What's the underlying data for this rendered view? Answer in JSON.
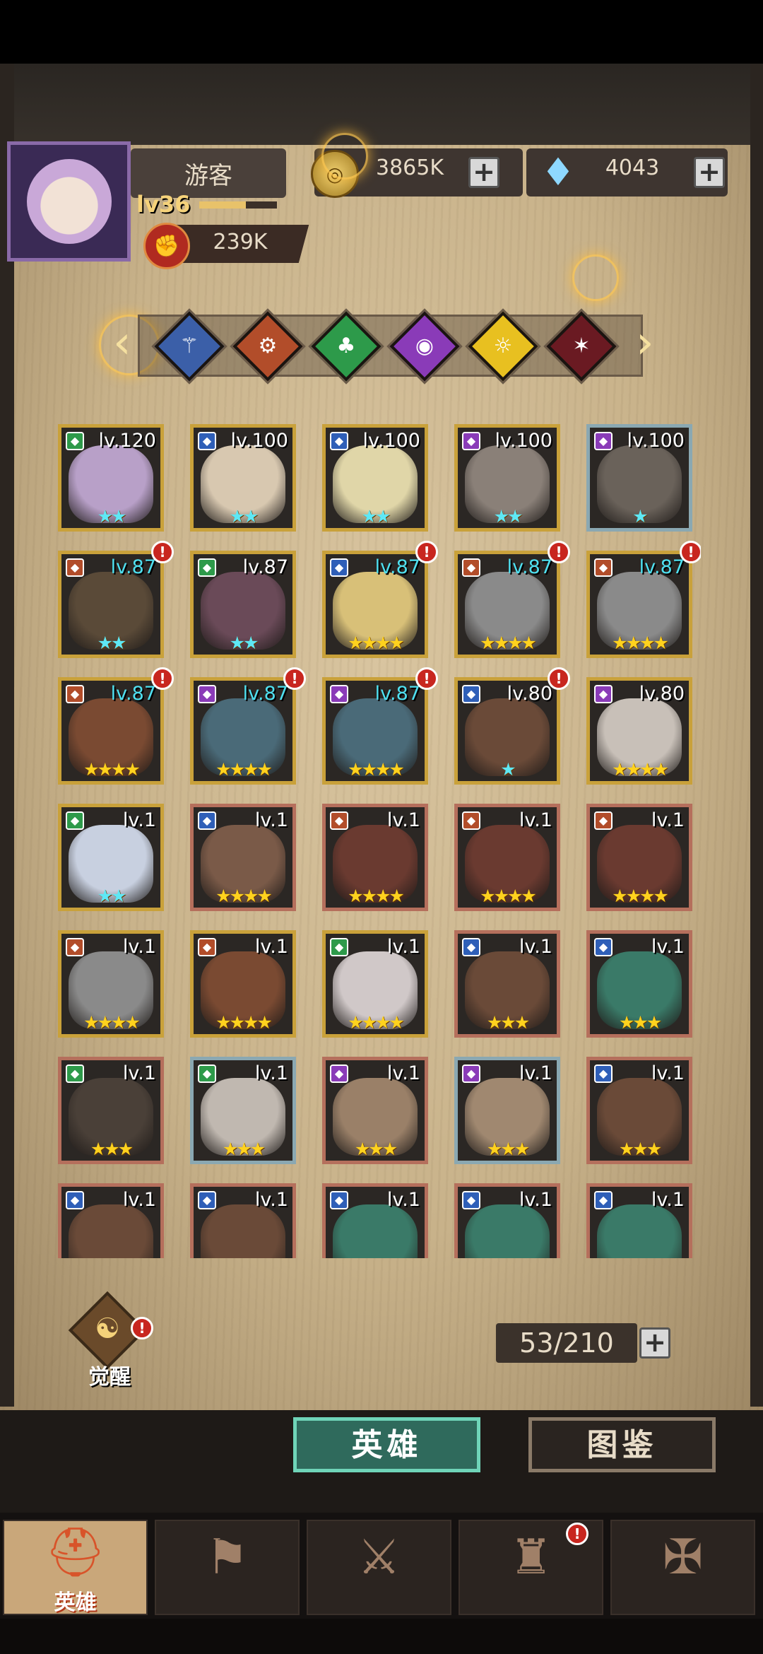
{
  "player": {
    "name": "游客",
    "level": "lv36",
    "xp_fraction": 0.6,
    "power": "239K"
  },
  "resources": {
    "gold": "3865K",
    "gems": "4043"
  },
  "factions": [
    {
      "icon": "wing-icon",
      "color": "#3b5fa8",
      "glyph": "⚚"
    },
    {
      "icon": "gear-icon",
      "color": "#b24d2a",
      "glyph": "⚙"
    },
    {
      "icon": "clover-icon",
      "color": "#2d9a4a",
      "glyph": "♣"
    },
    {
      "icon": "eye-icon",
      "color": "#8a3bb8",
      "glyph": "◉"
    },
    {
      "icon": "sun-eye-icon",
      "color": "#e8c020",
      "glyph": "☼"
    },
    {
      "icon": "demon-icon",
      "color": "#6a1a22",
      "glyph": "✶"
    }
  ],
  "heroes": [
    {
      "level": "lv.120",
      "stars": "★★",
      "star_color": "cyan",
      "lv_color": "white",
      "class_color": "#2e9a4a",
      "frame": "gold",
      "alert": false,
      "portrait": "#b8a0c8"
    },
    {
      "level": "lv.100",
      "stars": "★★",
      "star_color": "cyan",
      "lv_color": "white",
      "class_color": "#2f5fb8",
      "frame": "gold",
      "alert": false,
      "portrait": "#d8c8b0"
    },
    {
      "level": "lv.100",
      "stars": "★★",
      "star_color": "cyan",
      "lv_color": "white",
      "class_color": "#2f5fb8",
      "frame": "gold",
      "alert": false,
      "portrait": "#e0d6a8"
    },
    {
      "level": "lv.100",
      "stars": "★★",
      "star_color": "cyan",
      "lv_color": "white",
      "class_color": "#8a3bb8",
      "frame": "gold",
      "alert": false,
      "portrait": "#8a8078"
    },
    {
      "level": "lv.100",
      "stars": "★",
      "star_color": "cyan",
      "lv_color": "white",
      "class_color": "#8a3bb8",
      "frame": "teal",
      "alert": false,
      "portrait": "#6a625a"
    },
    {
      "level": "lv.87",
      "stars": "★★",
      "star_color": "cyan",
      "lv_color": "cyan",
      "class_color": "#b24d2a",
      "frame": "gold",
      "alert": true,
      "portrait": "#5a4a38"
    },
    {
      "level": "lv.87",
      "stars": "★★",
      "star_color": "cyan",
      "lv_color": "white",
      "class_color": "#2e9a4a",
      "frame": "gold",
      "alert": false,
      "portrait": "#6a4a58"
    },
    {
      "level": "lv.87",
      "stars": "★★★★",
      "star_color": "gold",
      "lv_color": "cyan",
      "class_color": "#2f5fb8",
      "frame": "gold",
      "alert": true,
      "portrait": "#d8c078"
    },
    {
      "level": "lv.87",
      "stars": "★★★★",
      "star_color": "gold",
      "lv_color": "cyan",
      "class_color": "#b24d2a",
      "frame": "gold",
      "alert": true,
      "portrait": "#8a8a8a"
    },
    {
      "level": "lv.87",
      "stars": "★★★★",
      "star_color": "gold",
      "lv_color": "cyan",
      "class_color": "#b24d2a",
      "frame": "gold",
      "alert": true,
      "portrait": "#8a8a8a"
    },
    {
      "level": "lv.87",
      "stars": "★★★★",
      "star_color": "gold",
      "lv_color": "cyan",
      "class_color": "#b24d2a",
      "frame": "gold",
      "alert": true,
      "portrait": "#7a4a32"
    },
    {
      "level": "lv.87",
      "stars": "★★★★",
      "star_color": "gold",
      "lv_color": "cyan",
      "class_color": "#8a3bb8",
      "frame": "gold",
      "alert": true,
      "portrait": "#4a6a78"
    },
    {
      "level": "lv.87",
      "stars": "★★★★",
      "star_color": "gold",
      "lv_color": "cyan",
      "class_color": "#8a3bb8",
      "frame": "gold",
      "alert": true,
      "portrait": "#4a6a78"
    },
    {
      "level": "lv.80",
      "stars": "★",
      "star_color": "cyan",
      "lv_color": "white",
      "class_color": "#2f5fb8",
      "frame": "gold",
      "alert": true,
      "portrait": "#6a4a38"
    },
    {
      "level": "lv.80",
      "stars": "★★★★",
      "star_color": "gold",
      "lv_color": "white",
      "class_color": "#8a3bb8",
      "frame": "gold",
      "alert": false,
      "portrait": "#c8c0b8"
    },
    {
      "level": "lv.1",
      "stars": "★★",
      "star_color": "cyan",
      "lv_color": "white",
      "class_color": "#2e9a4a",
      "frame": "gold",
      "alert": false,
      "portrait": "#c8d0e0"
    },
    {
      "level": "lv.1",
      "stars": "★★★★",
      "star_color": "gold",
      "lv_color": "white",
      "class_color": "#2f5fb8",
      "frame": "red",
      "alert": false,
      "portrait": "#7a5a48"
    },
    {
      "level": "lv.1",
      "stars": "★★★★",
      "star_color": "gold",
      "lv_color": "white",
      "class_color": "#b24d2a",
      "frame": "red",
      "alert": false,
      "portrait": "#6a3a30"
    },
    {
      "level": "lv.1",
      "stars": "★★★★",
      "star_color": "gold",
      "lv_color": "white",
      "class_color": "#b24d2a",
      "frame": "red",
      "alert": false,
      "portrait": "#6a3a30"
    },
    {
      "level": "lv.1",
      "stars": "★★★★",
      "star_color": "gold",
      "lv_color": "white",
      "class_color": "#b24d2a",
      "frame": "red",
      "alert": false,
      "portrait": "#6a3a30"
    },
    {
      "level": "lv.1",
      "stars": "★★★★",
      "star_color": "gold",
      "lv_color": "white",
      "class_color": "#b24d2a",
      "frame": "gold",
      "alert": false,
      "portrait": "#8a8a8a"
    },
    {
      "level": "lv.1",
      "stars": "★★★★",
      "star_color": "gold",
      "lv_color": "white",
      "class_color": "#b24d2a",
      "frame": "gold",
      "alert": false,
      "portrait": "#7a4a32"
    },
    {
      "level": "lv.1",
      "stars": "★★★★",
      "star_color": "gold",
      "lv_color": "white",
      "class_color": "#2e9a4a",
      "frame": "gold",
      "alert": false,
      "portrait": "#d0c8c8"
    },
    {
      "level": "lv.1",
      "stars": "★★★",
      "star_color": "gold",
      "lv_color": "white",
      "class_color": "#2f5fb8",
      "frame": "red",
      "alert": false,
      "portrait": "#6a4a38"
    },
    {
      "level": "lv.1",
      "stars": "★★★",
      "star_color": "gold",
      "lv_color": "white",
      "class_color": "#2f5fb8",
      "frame": "red",
      "alert": false,
      "portrait": "#3a7a68"
    },
    {
      "level": "lv.1",
      "stars": "★★★",
      "star_color": "gold",
      "lv_color": "white",
      "class_color": "#2e9a4a",
      "frame": "red",
      "alert": false,
      "portrait": "#4a4038"
    },
    {
      "level": "lv.1",
      "stars": "★★★",
      "star_color": "gold",
      "lv_color": "white",
      "class_color": "#2e9a4a",
      "frame": "teal",
      "alert": false,
      "portrait": "#c0b8b0"
    },
    {
      "level": "lv.1",
      "stars": "★★★",
      "star_color": "gold",
      "lv_color": "white",
      "class_color": "#8a3bb8",
      "frame": "red",
      "alert": false,
      "portrait": "#9a8068"
    },
    {
      "level": "lv.1",
      "stars": "★★★",
      "star_color": "gold",
      "lv_color": "white",
      "class_color": "#8a3bb8",
      "frame": "teal",
      "alert": false,
      "portrait": "#a08870"
    },
    {
      "level": "lv.1",
      "stars": "★★★",
      "star_color": "gold",
      "lv_color": "white",
      "class_color": "#2f5fb8",
      "frame": "red",
      "alert": false,
      "portrait": "#6a4a38"
    },
    {
      "level": "lv.1",
      "stars": "",
      "star_color": "gold",
      "lv_color": "white",
      "class_color": "#2f5fb8",
      "frame": "red",
      "alert": false,
      "portrait": "#6a4a38"
    },
    {
      "level": "lv.1",
      "stars": "",
      "star_color": "gold",
      "lv_color": "white",
      "class_color": "#2f5fb8",
      "frame": "red",
      "alert": false,
      "portrait": "#6a4a38"
    },
    {
      "level": "lv.1",
      "stars": "",
      "star_color": "gold",
      "lv_color": "white",
      "class_color": "#2f5fb8",
      "frame": "red",
      "alert": false,
      "portrait": "#3a7a68"
    },
    {
      "level": "lv.1",
      "stars": "",
      "star_color": "gold",
      "lv_color": "white",
      "class_color": "#2f5fb8",
      "frame": "red",
      "alert": false,
      "portrait": "#3a7a68"
    },
    {
      "level": "lv.1",
      "stars": "",
      "star_color": "gold",
      "lv_color": "white",
      "class_color": "#2f5fb8",
      "frame": "red",
      "alert": false,
      "portrait": "#3a7a68"
    }
  ],
  "awaken": {
    "label": "觉醒",
    "alert": "!"
  },
  "hero_count": "53/210",
  "tabs": {
    "heroes": "英雄",
    "codex": "图鉴"
  },
  "bottom_nav": [
    {
      "label": "英雄",
      "icon": "knight-helmet-icon",
      "glyph": "⛑",
      "active": true
    },
    {
      "label": "",
      "icon": "banner-flag-icon",
      "glyph": "⚑",
      "active": false
    },
    {
      "label": "",
      "icon": "crossed-swords-icon",
      "glyph": "⚔",
      "active": false
    },
    {
      "label": "",
      "icon": "castle-tower-icon",
      "glyph": "♜",
      "active": false,
      "alert": "!"
    },
    {
      "label": "",
      "icon": "guild-handshake-icon",
      "glyph": "✠",
      "active": false
    }
  ],
  "alert_glyph": "!"
}
